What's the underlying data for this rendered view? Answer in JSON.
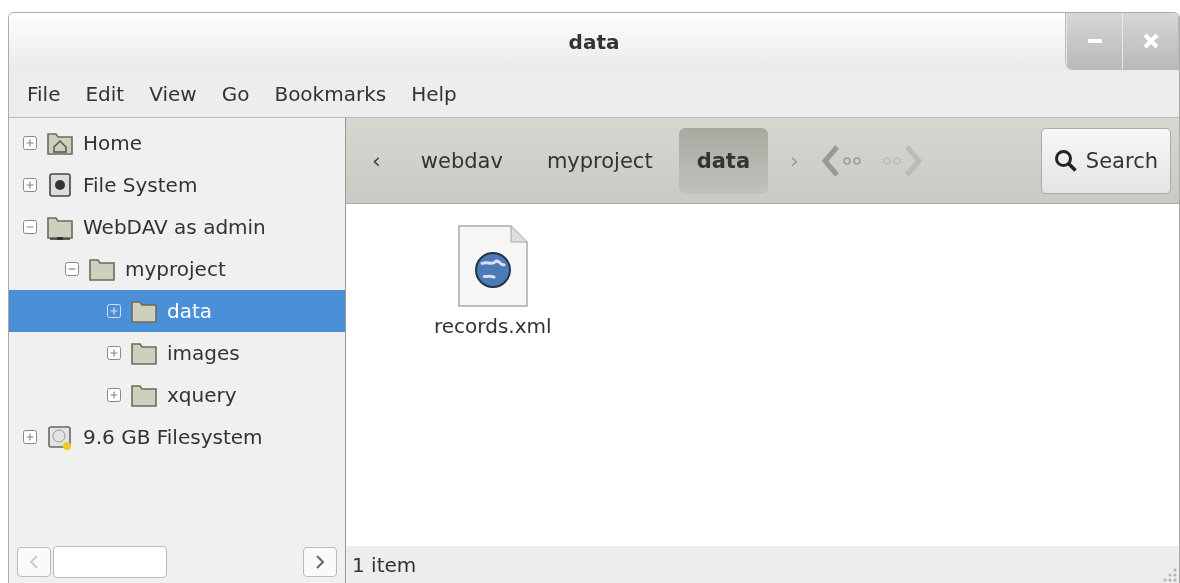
{
  "window": {
    "title": "data"
  },
  "menu": [
    "File",
    "Edit",
    "View",
    "Go",
    "Bookmarks",
    "Help"
  ],
  "sidebar": {
    "items": [
      {
        "label": "Home",
        "kind": "home",
        "expanded": false,
        "selected": false
      },
      {
        "label": "File System",
        "kind": "disk",
        "expanded": false,
        "selected": false
      },
      {
        "label": "WebDAV as admin",
        "kind": "network",
        "expanded": true,
        "selected": false,
        "children": [
          {
            "label": "myproject",
            "kind": "folder",
            "expanded": true,
            "selected": false,
            "children": [
              {
                "label": "data",
                "kind": "folder",
                "expanded": false,
                "selected": true
              },
              {
                "label": "images",
                "kind": "folder",
                "expanded": false,
                "selected": false
              },
              {
                "label": "xquery",
                "kind": "folder",
                "expanded": false,
                "selected": false
              }
            ]
          }
        ]
      },
      {
        "label": "9.6 GB Filesystem",
        "kind": "drive",
        "expanded": false,
        "selected": false
      }
    ]
  },
  "pathbar": {
    "back": "‹",
    "forward": "›",
    "crumbs": [
      {
        "label": "webdav",
        "selected": false
      },
      {
        "label": "myproject",
        "selected": false
      },
      {
        "label": "data",
        "selected": true
      }
    ],
    "search": "Search"
  },
  "files": [
    {
      "name": "records.xml",
      "kind": "xml"
    }
  ],
  "status_bar": "1 item"
}
